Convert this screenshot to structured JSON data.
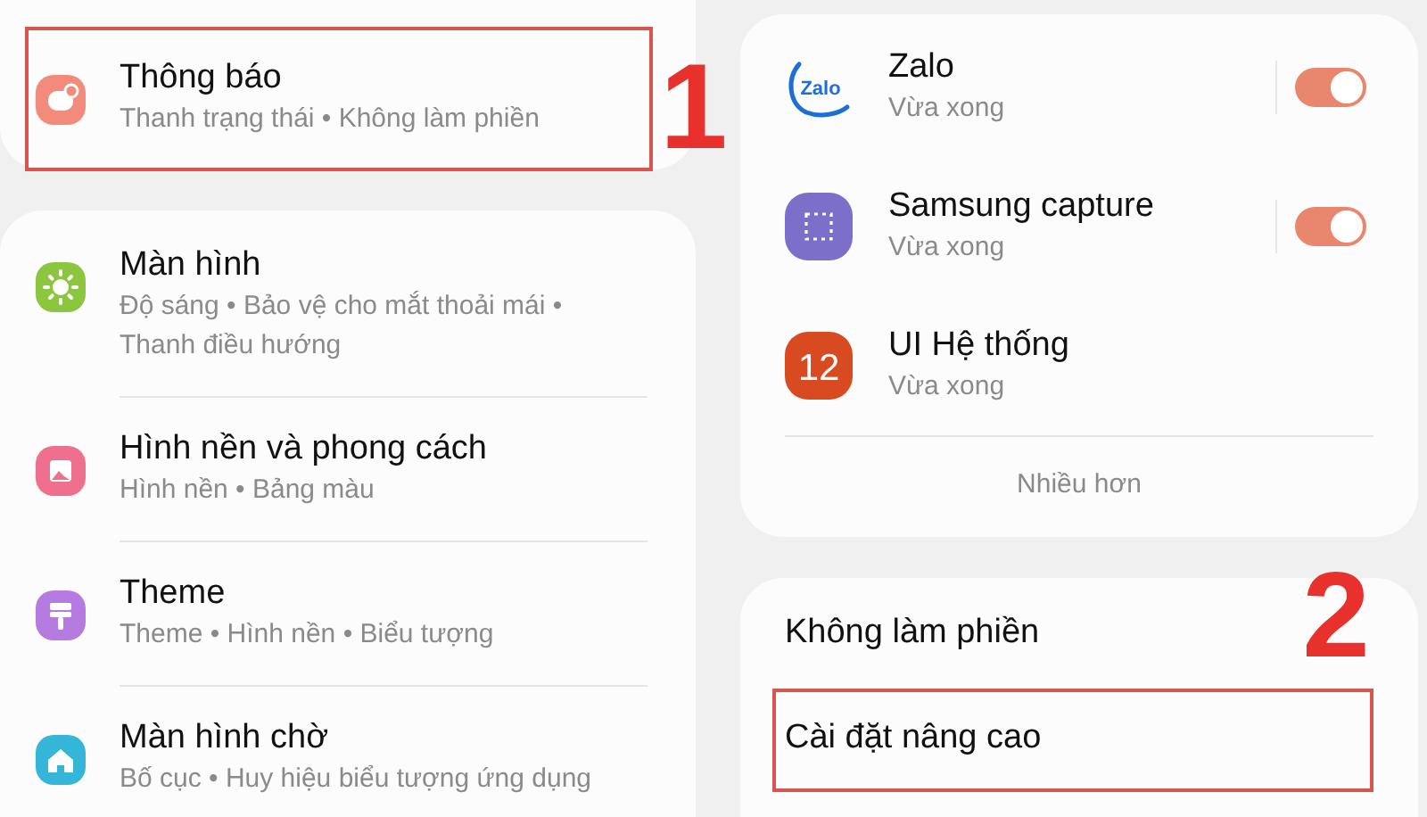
{
  "left_panel": {
    "top_item": {
      "title": "Thông báo",
      "subtitle": "Thanh trạng thái • Không làm phiền",
      "highlighted": true,
      "step": "1"
    },
    "items": [
      {
        "title": "Màn hình",
        "subtitle": "Độ sáng • Bảo vệ cho mắt thoải mái • Thanh điều hướng"
      },
      {
        "title": "Hình nền và phong cách",
        "subtitle": "Hình nền • Bảng màu"
      },
      {
        "title": "Theme",
        "subtitle": "Theme • Hình nền • Biểu tượng"
      },
      {
        "title": "Màn hình chờ",
        "subtitle": "Bố cục • Huy hiệu biểu tượng ứng dụng"
      }
    ]
  },
  "right_panel": {
    "apps": [
      {
        "name": "Zalo",
        "icon_text": "Zalo",
        "time": "Vừa xong",
        "on": true
      },
      {
        "name": "Samsung capture",
        "time": "Vừa xong",
        "on": true
      },
      {
        "name": "UI Hệ thống",
        "icon_text": "12",
        "time": "Vừa xong"
      }
    ],
    "more": "Nhiều hơn",
    "settings": [
      {
        "label": "Không làm phiền",
        "highlighted": false
      },
      {
        "label": "Cài đặt nâng cao",
        "highlighted": true,
        "step": "2"
      }
    ]
  }
}
